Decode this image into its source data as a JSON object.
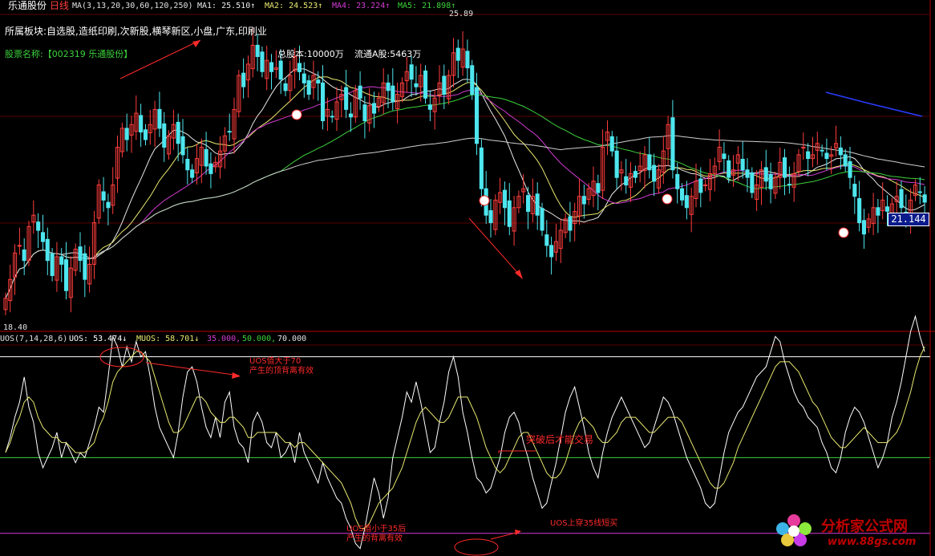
{
  "header": {
    "stock_name": "乐通股份",
    "period": "日线",
    "ma_params": "MA(3,13,20,30,60,120,250)",
    "ma1": "MA1: 25.510↑",
    "ma2": "MA2: 24.523↑",
    "ma4": "MA4: 23.224↑",
    "ma5": "MA5: 21.898↑"
  },
  "info": {
    "sector_line": "所属板块:自选股,造纸印刷,次新股,横琴新区,小盘,广东,印刷业",
    "name_label": "股票名称:【002319 乐通股份】",
    "total_shares": "总股本:10000万",
    "float_shares": "流通A股:5463万"
  },
  "price_labels": {
    "high": "25.89",
    "low": "18.40",
    "last": "21.144"
  },
  "indicator": {
    "params": "UOS(7,14,28,6)",
    "uos": "UOS: 53.474↓",
    "muos": "MUOS: 58.701↓",
    "lines": [
      "35.000,",
      "50.000,",
      "70.000"
    ]
  },
  "annotations": {
    "above70_l1": "UOS值大于70",
    "above70_l2": "产生的顶背离有效",
    "breakthrough": "突破后才能交易",
    "below35_l1": "UOS值小于35后",
    "below35_l2": "产生的背离有效",
    "cross35": "UOS上穿35线短买"
  },
  "watermark": {
    "title": "分析家公式网",
    "url": "www.88gs.com"
  },
  "colors": {
    "up": "#ff3d3d",
    "down": "#4ee6ee",
    "ma_white": "#e8e8e8",
    "ma_yellow": "#e8e870",
    "ma_magenta": "#d23cd2",
    "ma_green": "#3cd23c",
    "ma_blue": "#2a3cff",
    "level_70": "#ffffff",
    "level_50": "#3cd23c",
    "level_35": "#d23cd2",
    "uos": "#ffffff",
    "muos": "#e8e870",
    "annotation": "#ff2a2a"
  },
  "chart_data": [
    {
      "type": "candlestick",
      "title": "乐通股份 日线",
      "x": [
        1,
        2,
        3,
        4,
        5,
        6,
        7,
        8,
        9,
        10,
        11,
        12,
        13,
        14,
        15,
        16,
        17,
        18,
        19,
        20,
        21,
        22,
        23,
        24,
        25,
        26,
        27,
        28,
        29,
        30,
        31,
        32,
        33,
        34,
        35,
        36,
        37,
        38,
        39,
        40,
        41,
        42,
        43,
        44,
        45,
        46,
        47,
        48,
        49,
        50,
        51,
        52,
        53,
        54,
        55,
        56,
        57,
        58,
        59,
        60,
        61,
        62,
        63,
        64,
        65,
        66,
        67,
        68,
        69,
        70,
        71,
        72,
        73,
        74,
        75,
        76,
        77,
        78,
        79,
        80,
        81,
        82,
        83,
        84,
        85,
        86,
        87,
        88,
        89,
        90,
        91,
        92,
        93,
        94,
        95,
        96,
        97,
        98,
        99,
        100,
        101,
        102,
        103,
        104,
        105,
        106,
        107,
        108,
        109,
        110,
        111,
        112,
        113,
        114,
        115,
        116,
        117,
        118,
        119,
        120,
        121,
        122,
        123,
        124,
        125,
        126,
        127,
        128,
        129,
        130,
        131,
        132,
        133,
        134,
        135,
        136,
        137,
        138,
        139,
        140,
        141,
        142,
        143,
        144,
        145,
        146,
        147,
        148,
        149,
        150,
        151,
        152,
        153,
        154,
        155,
        156,
        157,
        158,
        159,
        160,
        161,
        162,
        163,
        164,
        165,
        166,
        167,
        168,
        169,
        170,
        171,
        172,
        173,
        174,
        175,
        176,
        177,
        178,
        179,
        180,
        181,
        182,
        183,
        184,
        185,
        186,
        187,
        188,
        189,
        190,
        191,
        192,
        193,
        194,
        195,
        196,
        197,
        198,
        199,
        200
      ],
      "close": [
        18.6,
        19.1,
        19.8,
        20.0,
        19.6,
        20.5,
        20.8,
        20.4,
        20.1,
        19.6,
        19.2,
        19.7,
        19.5,
        18.8,
        19.4,
        19.9,
        19.6,
        19.1,
        19.5,
        20.6,
        21.6,
        21.2,
        21.0,
        21.6,
        22.6,
        23.1,
        22.8,
        23.2,
        23.5,
        23.0,
        22.8,
        23.2,
        23.6,
        23.1,
        22.6,
        22.9,
        23.2,
        22.7,
        22.4,
        22.0,
        21.8,
        22.3,
        22.6,
        22.1,
        21.9,
        22.2,
        22.5,
        22.9,
        23.0,
        23.6,
        24.5,
        24.2,
        24.8,
        25.3,
        25.0,
        24.6,
        24.9,
        24.6,
        24.7,
        24.4,
        24.1,
        24.5,
        25.0,
        24.6,
        24.3,
        24.0,
        24.5,
        24.3,
        23.3,
        23.6,
        23.4,
        23.8,
        24.0,
        23.6,
        23.4,
        24.1,
        23.9,
        23.3,
        23.7,
        23.5,
        23.9,
        24.3,
        24.1,
        23.8,
        24.0,
        24.3,
        24.6,
        24.4,
        24.2,
        24.5,
        23.9,
        23.6,
        23.9,
        24.3,
        24.0,
        24.5,
        25.1,
        24.9,
        25.2,
        24.7,
        24.0,
        22.7,
        21.5,
        20.8,
        20.6,
        21.2,
        21.4,
        21.0,
        20.5,
        21.0,
        21.3,
        21.5,
        20.9,
        21.3,
        20.8,
        20.4,
        20.0,
        19.7,
        20.1,
        20.4,
        20.7,
        20.4,
        20.9,
        21.3,
        21.1,
        21.5,
        21.7,
        21.4,
        22.6,
        23.0,
        22.5,
        21.8,
        22.0,
        21.6,
        21.9,
        21.8,
        22.1,
        22.4,
        22.0,
        21.7,
        22.0,
        22.5,
        23.2,
        22.0,
        21.5,
        21.2,
        21.0,
        21.3,
        21.7,
        21.4,
        21.6,
        21.9,
        22.1,
        22.6,
        22.3,
        21.8,
        22.0,
        22.4,
        22.0,
        21.8,
        21.4,
        21.6,
        22.0,
        21.7,
        21.5,
        21.8,
        22.2,
        21.8,
        21.6,
        21.9,
        22.4,
        22.6,
        22.3,
        22.4,
        22.7,
        22.5,
        22.3,
        22.4,
        22.7,
        22.4,
        22.1,
        21.8,
        21.3,
        20.6,
        20.3,
        20.7,
        21.0,
        20.8,
        21.2,
        20.9,
        21.1,
        21.3,
        21.0,
        20.7,
        21.2,
        21.6,
        21.4,
        21.144
      ]
    },
    {
      "type": "line",
      "title": "UOS(7,14,28,6)",
      "ylim": [
        31,
        72
      ],
      "levels": [
        35,
        50,
        70
      ],
      "series": [
        {
          "name": "UOS",
          "values": [
            51,
            54,
            58,
            61,
            66,
            60,
            57,
            51,
            48,
            50,
            52,
            55,
            50,
            53,
            51,
            49,
            51,
            50,
            53,
            56,
            60,
            59,
            66,
            74,
            72,
            68,
            72,
            69,
            73,
            70,
            71,
            66,
            60,
            56,
            54,
            52,
            50,
            55,
            62,
            67,
            68,
            65,
            60,
            56,
            54,
            58,
            54,
            61,
            63,
            56,
            53,
            52,
            49,
            57,
            59,
            57,
            53,
            52,
            55,
            50,
            51,
            53,
            49,
            55,
            51,
            49,
            47,
            45,
            49,
            46,
            44,
            42,
            41,
            38,
            36,
            33,
            32,
            36,
            41,
            46,
            43,
            38,
            42,
            50,
            54,
            58,
            63,
            61,
            65,
            61,
            56,
            51,
            52,
            57,
            61,
            67,
            70,
            66,
            59,
            55,
            50,
            46,
            45,
            43,
            44,
            47,
            50,
            55,
            58,
            59,
            57,
            53,
            50,
            46,
            43,
            40,
            41,
            45,
            49,
            54,
            59,
            62,
            64,
            60,
            56,
            51,
            48,
            46,
            51,
            55,
            58,
            60,
            62,
            60,
            58,
            56,
            54,
            52,
            53,
            56,
            59,
            62,
            61,
            59,
            56,
            53,
            50,
            48,
            46,
            44,
            41,
            40,
            41,
            46,
            51,
            55,
            57,
            59,
            60,
            62,
            64,
            66,
            67,
            68,
            71,
            74,
            73,
            69,
            66,
            63,
            61,
            60,
            58,
            57,
            56,
            53,
            51,
            48,
            47,
            50,
            55,
            58,
            60,
            59,
            57,
            54,
            51,
            48,
            50,
            53,
            58,
            61,
            65,
            70,
            75,
            78,
            74,
            71
          ]
        },
        {
          "name": "MUOS",
          "values": [
            51,
            53,
            56,
            58,
            61,
            62,
            61,
            58,
            56,
            55,
            54,
            54,
            53,
            53,
            52,
            51,
            51,
            51,
            52,
            53,
            56,
            58,
            61,
            65,
            67,
            68,
            69,
            70,
            71,
            71,
            70,
            69,
            66,
            63,
            60,
            57,
            55,
            55,
            56,
            58,
            60,
            62,
            62,
            61,
            59,
            58,
            57,
            57,
            58,
            58,
            57,
            56,
            54,
            54,
            55,
            55,
            55,
            55,
            55,
            54,
            53,
            53,
            52,
            53,
            53,
            52,
            51,
            50,
            49,
            48,
            47,
            46,
            45,
            43,
            41,
            38,
            36,
            36,
            37,
            39,
            41,
            42,
            43,
            44,
            46,
            48,
            51,
            54,
            57,
            59,
            60,
            59,
            58,
            57,
            57,
            58,
            60,
            62,
            62,
            62,
            60,
            58,
            55,
            52,
            50,
            48,
            47,
            48,
            50,
            52,
            54,
            55,
            55,
            53,
            51,
            49,
            47,
            46,
            46,
            47,
            49,
            52,
            55,
            57,
            58,
            57,
            56,
            54,
            53,
            53,
            54,
            55,
            57,
            58,
            58,
            58,
            57,
            56,
            55,
            55,
            56,
            57,
            58,
            58,
            58,
            57,
            55,
            53,
            51,
            49,
            47,
            45,
            44,
            44,
            45,
            47,
            49,
            52,
            54,
            56,
            58,
            60,
            62,
            64,
            66,
            68,
            69,
            69,
            69,
            68,
            67,
            65,
            63,
            61,
            60,
            58,
            56,
            54,
            53,
            52,
            52,
            53,
            54,
            55,
            56,
            55,
            54,
            53,
            53,
            53,
            54,
            55,
            57,
            60,
            63,
            67,
            70,
            72
          ]
        }
      ]
    }
  ]
}
